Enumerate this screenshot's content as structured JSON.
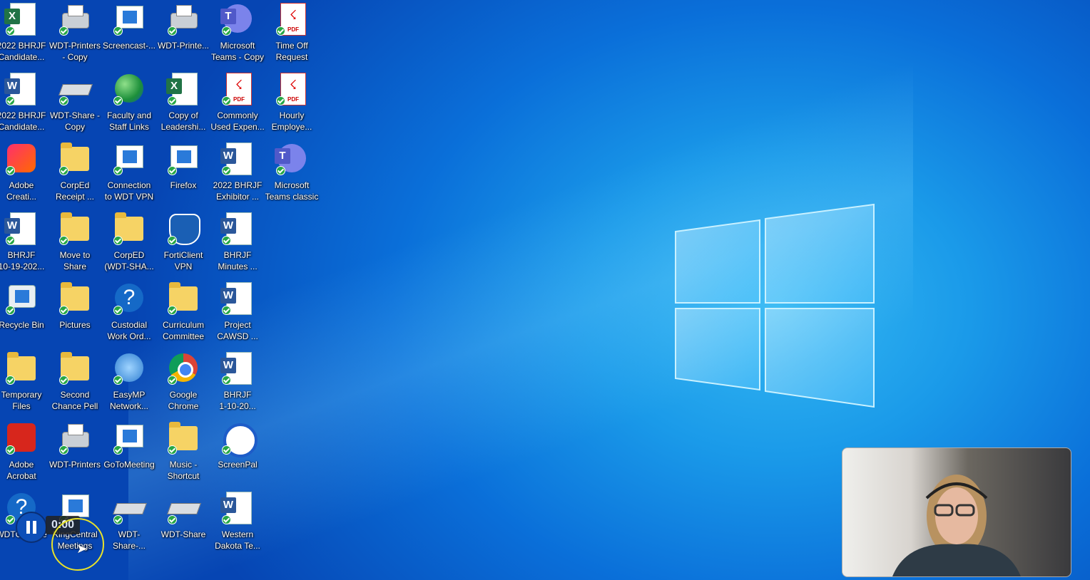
{
  "desktop_icons": [
    {
      "label": "2022 BHRJF\nCandidate...",
      "type": "excel"
    },
    {
      "label": "WDT-Printers\n- Copy",
      "type": "printer"
    },
    {
      "label": "Screencast-...",
      "type": "screen"
    },
    {
      "label": "WDT-Printe...",
      "type": "printer"
    },
    {
      "label": "Microsoft\nTeams - Copy",
      "type": "teams"
    },
    {
      "label": "Time Off\nRequest",
      "type": "pdf"
    },
    {
      "label": "2022 BHRJF\nCandidate...",
      "type": "word"
    },
    {
      "label": "WDT-Share -\nCopy",
      "type": "drive"
    },
    {
      "label": "Faculty and\nStaff Links",
      "type": "globe"
    },
    {
      "label": "Copy of\nLeadershi...",
      "type": "excel"
    },
    {
      "label": "Commonly\nUsed Expen...",
      "type": "pdf"
    },
    {
      "label": "Hourly\nEmploye...",
      "type": "pdf"
    },
    {
      "label": "Adobe\nCreati...",
      "type": "adobecc"
    },
    {
      "label": "CorpEd\nReceipt ...",
      "type": "folder"
    },
    {
      "label": "Connection\nto WDT VPN",
      "type": "screen"
    },
    {
      "label": "Firefox",
      "type": "screen"
    },
    {
      "label": "2022 BHRJF\nExhibitor ...",
      "type": "word"
    },
    {
      "label": "Microsoft\nTeams classic",
      "type": "teams"
    },
    {
      "label": "BHRJF\n10-19-202...",
      "type": "word"
    },
    {
      "label": "Move to\nShare",
      "type": "folder"
    },
    {
      "label": "CorpED\n(WDT-SHA...",
      "type": "folder"
    },
    {
      "label": "FortiClient\nVPN",
      "type": "shield"
    },
    {
      "label": "BHRJF\nMinutes ...",
      "type": "word"
    },
    {
      "label": "",
      "type": "none"
    },
    {
      "label": "Recycle Bin",
      "type": "recycle"
    },
    {
      "label": "Pictures",
      "type": "folder"
    },
    {
      "label": "Custodial\nWork Ord...",
      "type": "help"
    },
    {
      "label": "Curriculum\nCommittee",
      "type": "folder"
    },
    {
      "label": "Project\nCAWSD ...",
      "type": "word"
    },
    {
      "label": "",
      "type": "none"
    },
    {
      "label": "Temporary\nFiles",
      "type": "folder"
    },
    {
      "label": "Second\nChance Pell",
      "type": "folder"
    },
    {
      "label": "EasyMP\nNetwork...",
      "type": "easymp"
    },
    {
      "label": "Google\nChrome",
      "type": "chrome"
    },
    {
      "label": "BHRJF\n1-10-20...",
      "type": "word"
    },
    {
      "label": "",
      "type": "none"
    },
    {
      "label": "Adobe\nAcrobat",
      "type": "acrobat"
    },
    {
      "label": "WDT-Printers",
      "type": "printer"
    },
    {
      "label": "GoToMeeting",
      "type": "screen"
    },
    {
      "label": "Music -\nShortcut",
      "type": "folder"
    },
    {
      "label": "ScreenPal",
      "type": "screenpal"
    },
    {
      "label": "",
      "type": "none"
    },
    {
      "label": "WDTC Inside",
      "type": "help"
    },
    {
      "label": "RingCentral\nMeetings",
      "type": "screen"
    },
    {
      "label": "WDT-Share-...",
      "type": "drive"
    },
    {
      "label": "WDT-Share",
      "type": "drive"
    },
    {
      "label": "Western\nDakota Te...",
      "type": "word"
    },
    {
      "label": "",
      "type": "none"
    }
  ],
  "recorder": {
    "timer": "0:00",
    "pause_icon": "pause-icon"
  },
  "webcam": {
    "label": "webcam-overlay"
  },
  "colors": {
    "accent": "#1a9ae9",
    "word": "#2b579a",
    "excel": "#217346",
    "pdf": "#d9241b",
    "teams": "#5059c9"
  }
}
